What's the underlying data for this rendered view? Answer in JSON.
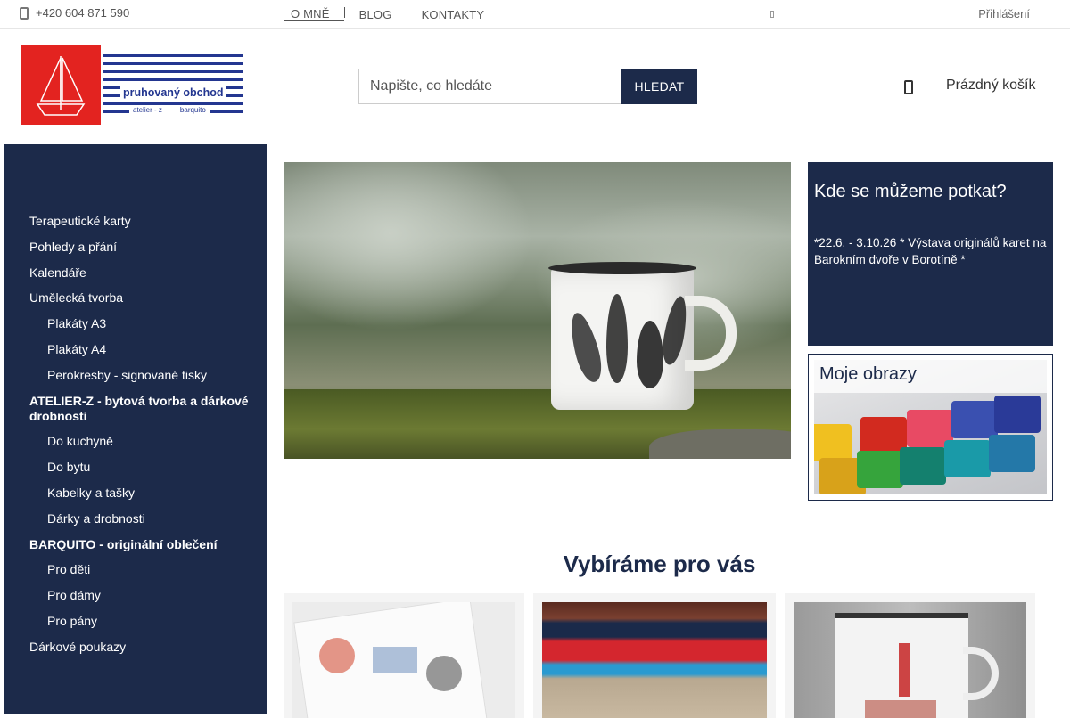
{
  "topbar": {
    "phone": "+420 604 871 590",
    "nav": [
      {
        "label": "O MNĚ"
      },
      {
        "label": "BLOG"
      },
      {
        "label": "KONTAKTY"
      }
    ],
    "login": "Přihlášení"
  },
  "header": {
    "logo_brand": "pruhovaný obchod",
    "logo_sub_left": "atelier - z",
    "logo_sub_right": "barquito",
    "search_placeholder": "Napište, co hledáte",
    "search_button": "HLEDAT",
    "cart_label": "Prázdný košík"
  },
  "sidebar": {
    "items": [
      {
        "label": "Terapeutické karty",
        "level": 0
      },
      {
        "label": "Pohledy a přání",
        "level": 0
      },
      {
        "label": "Kalendáře",
        "level": 0
      },
      {
        "label": "Umělecká tvorba",
        "level": 0
      },
      {
        "label": "Plakáty A3",
        "level": 1
      },
      {
        "label": "Plakáty A4",
        "level": 1
      },
      {
        "label": "Perokresby - signované tisky",
        "level": 1
      },
      {
        "label": "ATELIER-Z - bytová tvorba a dárkové drobnosti",
        "level": 0,
        "bold": true
      },
      {
        "label": "Do kuchyně",
        "level": 1
      },
      {
        "label": "Do bytu",
        "level": 1
      },
      {
        "label": "Kabelky a tašky",
        "level": 1
      },
      {
        "label": "Dárky a drobnosti",
        "level": 1
      },
      {
        "label": "BARQUITO - originální oblečení",
        "level": 0,
        "bold": true
      },
      {
        "label": "Pro děti",
        "level": 1
      },
      {
        "label": "Pro dámy",
        "level": 1
      },
      {
        "label": "Pro pány",
        "level": 1
      },
      {
        "label": "Dárkové poukazy",
        "level": 0
      }
    ]
  },
  "meet": {
    "title": "Kde se můžeme potkat?",
    "text": "*22.6. - 3.10.26 * Výstava originálů karet na Barokním dvoře v Borotíně *"
  },
  "paintings": {
    "title": "Moje obrazy"
  },
  "recommendations": {
    "title": "Vybíráme pro vás"
  },
  "colors": {
    "navy": "#1c2a4a",
    "brand_red": "#e32320",
    "brand_blue": "#233690"
  }
}
